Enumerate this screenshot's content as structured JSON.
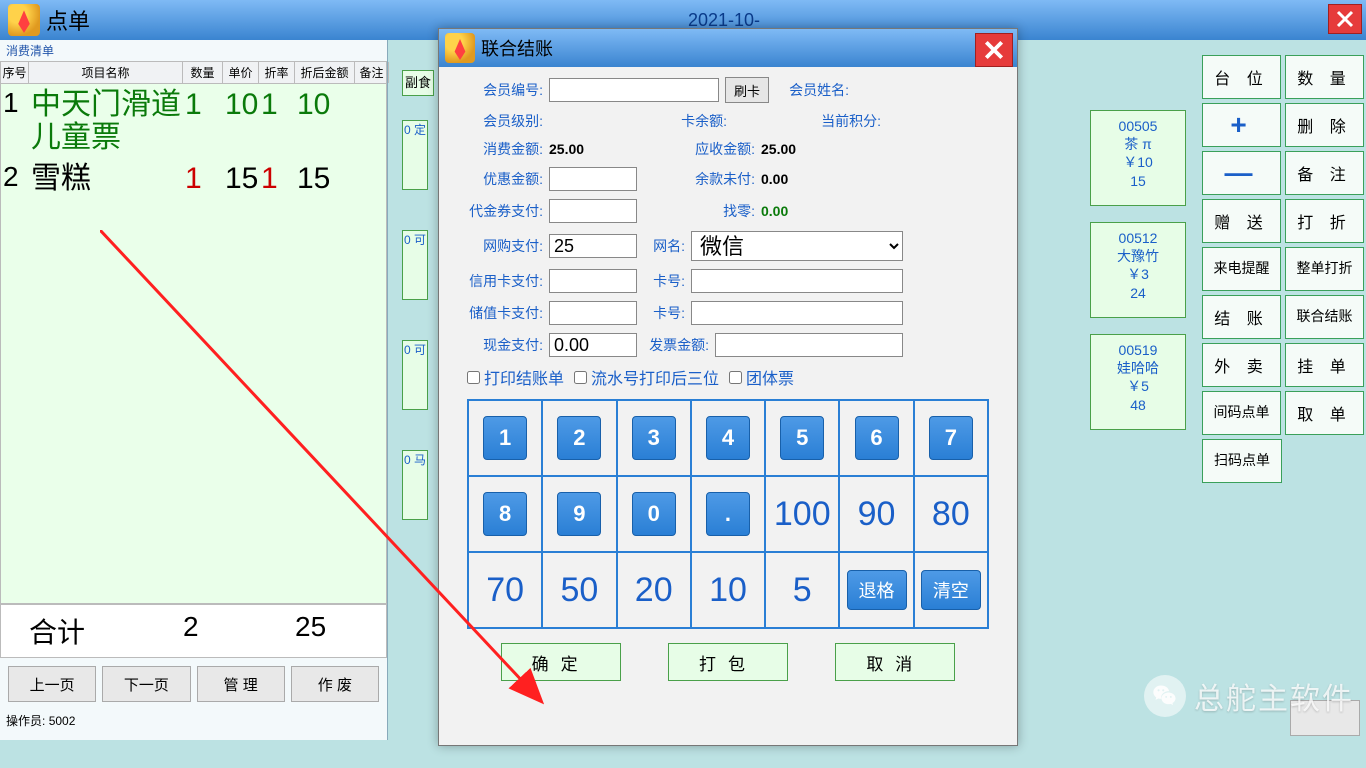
{
  "main": {
    "title": "点单",
    "date": "2021-10-"
  },
  "order": {
    "group_label": "消费清单",
    "headers": {
      "seq": "序号",
      "name": "项目名称",
      "qty": "数量",
      "price": "单价",
      "disc": "折率",
      "amt": "折后金额",
      "remark": "备注"
    },
    "rows": [
      {
        "idx": "1",
        "name": "中天门滑道儿童票",
        "qty": "1",
        "price": "10",
        "disc": "1",
        "amt": "10",
        "green": true
      },
      {
        "idx": "2",
        "name": "雪糕",
        "qty": "1",
        "price": "15",
        "disc": "1",
        "amt": "15",
        "green": false
      }
    ],
    "totals": {
      "label": "合计",
      "qty": "2",
      "amt": "25"
    },
    "btns": {
      "prev": "上一页",
      "next": "下一页",
      "manage": "管  理",
      "void": "作  废"
    },
    "operator_label": "操作员:",
    "operator_value": "5002"
  },
  "fushi": "副食",
  "slivers": {
    "a": "0\n定",
    "b": "0\n可",
    "c": "0\n可",
    "d": "0\n马"
  },
  "cards": [
    {
      "code": "00505",
      "name": "茶 π",
      "price": "￥10",
      "qty": "15"
    },
    {
      "code": "00512",
      "name": "大豫竹",
      "price": "￥3",
      "qty": "24"
    },
    {
      "code": "00519",
      "name": "娃哈哈",
      "price": "￥5",
      "qty": "48"
    }
  ],
  "rp": {
    "btns1": [
      "台  位",
      "数  量",
      "删  除",
      "备  注",
      "赠  送",
      "打  折",
      "来电提醒",
      "整单打折",
      "结  账",
      "联合结账",
      "外  卖",
      "挂  单",
      "间码点单",
      "取  单",
      "扫码点单"
    ],
    "plus": "+",
    "minus": "—"
  },
  "modal": {
    "title": "联合结账",
    "member_id_label": "会员编号:",
    "swipe_btn": "刷卡",
    "member_name_label": "会员姓名:",
    "member_level_label": "会员级别:",
    "card_balance_label": "卡余额:",
    "points_label": "当前积分:",
    "consume_label": "消费金额:",
    "consume_val": "25.00",
    "receivable_label": "应收金额:",
    "receivable_val": "25.00",
    "discount_label": "优惠金额:",
    "unpaid_label": "余款未付:",
    "unpaid_val": "0.00",
    "voucher_label": "代金券支付:",
    "change_label": "找零:",
    "change_val": "0.00",
    "online_label": "网购支付:",
    "online_val": "25",
    "online_name_label": "网名:",
    "online_name_val": "微信",
    "credit_label": "信用卡支付:",
    "credit_card_label": "卡号:",
    "stored_label": "储值卡支付:",
    "stored_card_label": "卡号:",
    "cash_label": "现金支付:",
    "cash_val": "0.00",
    "invoice_label": "发票金额:",
    "check_print": "打印结账单",
    "check_serial": "流水号打印后三位",
    "check_group": "团体票",
    "keypad": {
      "row1": [
        "1",
        "2",
        "3",
        "4",
        "5",
        "6",
        "7"
      ],
      "row2": [
        "8",
        "9",
        "0",
        ".",
        "100",
        "90",
        "80"
      ],
      "row3": [
        "70",
        "50",
        "20",
        "10",
        "5",
        "退格",
        "清空"
      ]
    },
    "actions": {
      "ok": "确定",
      "pack": "打包",
      "cancel": "取消"
    }
  },
  "watermark": "总舵主软件",
  "page_next": "页"
}
